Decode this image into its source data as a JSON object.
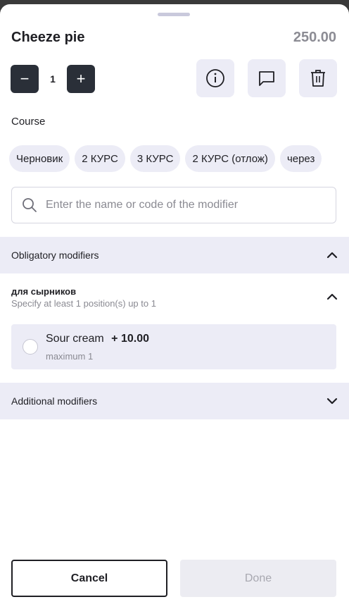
{
  "item": {
    "name": "Cheeze pie",
    "price": "250.00"
  },
  "quantity": {
    "minus_label": "−",
    "value": "1",
    "plus_label": "+"
  },
  "actions": [
    {
      "icon": "info-icon"
    },
    {
      "icon": "comment-icon"
    },
    {
      "icon": "trash-icon"
    }
  ],
  "course": {
    "label": "Course",
    "chips": [
      "Черновик",
      "2 КУРС",
      "3 КУРС",
      "2 КУРС (отлож)",
      "через"
    ]
  },
  "search": {
    "placeholder": "Enter the name or code of the modifier",
    "value": "",
    "icon": "search-icon"
  },
  "obligatory": {
    "header": "Obligatory modifiers",
    "expanded": true,
    "group": {
      "title": "для сырников",
      "subtitle": "Specify at least 1 position(s)  up to 1",
      "expanded": true,
      "items": [
        {
          "name": "Sour cream",
          "price": "+ 10.00",
          "limit": "maximum 1",
          "selected": false
        }
      ]
    }
  },
  "additional": {
    "header": "Additional modifiers",
    "expanded": false
  },
  "footer": {
    "cancel_label": "Cancel",
    "done_label": "Done"
  },
  "colors": {
    "dark_button": "#2a2f38",
    "section_bg": "#ececf6",
    "muted_text": "#8a8a92"
  }
}
